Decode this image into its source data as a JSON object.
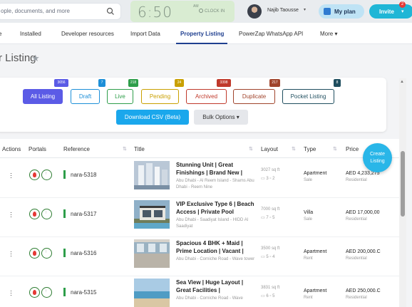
{
  "search": {
    "placeholder": "ople, documents, and more"
  },
  "clock": {
    "time": "6:50",
    "ampm": "AM",
    "button": "CLOCK IN"
  },
  "user": {
    "name": "Najib Taousse"
  },
  "plan": {
    "label": "My plan"
  },
  "invite": {
    "label": "Invite",
    "badge": "2"
  },
  "nav": {
    "tabs": [
      {
        "label": "e"
      },
      {
        "label": "Installed"
      },
      {
        "label": "Developer resources"
      },
      {
        "label": "Import Data"
      },
      {
        "label": "Property Listing"
      },
      {
        "label": "PowerZap WhatsApp API"
      },
      {
        "label": "More"
      }
    ],
    "active": "Property Listing"
  },
  "page": {
    "title": "r Listing"
  },
  "filters": [
    {
      "label": "All Listing",
      "count": "3656",
      "color": "#5b5be6"
    },
    {
      "label": "Draft",
      "count": "7",
      "color": "#1d8fd8"
    },
    {
      "label": "Live",
      "count": "218",
      "color": "#2e9e4a"
    },
    {
      "label": "Pending",
      "count": "24",
      "color": "#c9a000"
    },
    {
      "label": "Archived",
      "count": "3398",
      "color": "#c0392b"
    },
    {
      "label": "Duplicate",
      "count": "217",
      "color": "#a0442c"
    },
    {
      "label": "Pocket Listing",
      "count": "8",
      "color": "#1f4e5f"
    }
  ],
  "actions": {
    "csv": "Download CSV (Beta)",
    "bulk": "Bulk Options"
  },
  "table": {
    "headers": [
      "Actions",
      "Portals",
      "Reference",
      "Title",
      "Layout",
      "Type",
      "Price"
    ],
    "rows": [
      {
        "ref": "nara-5318",
        "title": "Stunning Unit | Great Finishings | Brand New |",
        "location": "Abu Dhabi - Al Reem Island - Shams Abu Dhabi - Reem Nine",
        "size": "3027 sq ft",
        "beds": "3",
        "baths": "2",
        "type": "Apartment",
        "purpose": "Sale",
        "price": "AED 4,233,275",
        "category": "Residential"
      },
      {
        "ref": "nara-5317",
        "title": "VIP Exclusive Type 6 | Beach Access | Private Pool",
        "location": "Abu Dhabi - Saadiyat Island - HIDD Al Saadiyat",
        "size": "7000 sq ft",
        "beds": "7",
        "baths": "5",
        "type": "Villa",
        "purpose": "Sale",
        "price": "AED 17,000,00",
        "category": "Residential"
      },
      {
        "ref": "nara-5316",
        "title": "Spacious 4 BHK + Maid | Prime Location | Vacant |",
        "location": "Abu Dhabi - Corniche Road - Wave tower",
        "size": "3500 sq ft",
        "beds": "5",
        "baths": "4",
        "type": "Apartment",
        "purpose": "Rent",
        "price": "AED 200,000.C",
        "category": "Residential"
      },
      {
        "ref": "nara-5315",
        "title": "Sea View | Huge Layout | Great Facilities |",
        "location": "Abu Dhabi - Corniche Road - Wave",
        "size": "3831 sq ft",
        "beds": "6",
        "baths": "5",
        "type": "Apartment",
        "purpose": "Rent",
        "price": "AED 250,000.C",
        "category": "Residential"
      }
    ]
  },
  "fab": {
    "label": "Create Listing"
  }
}
